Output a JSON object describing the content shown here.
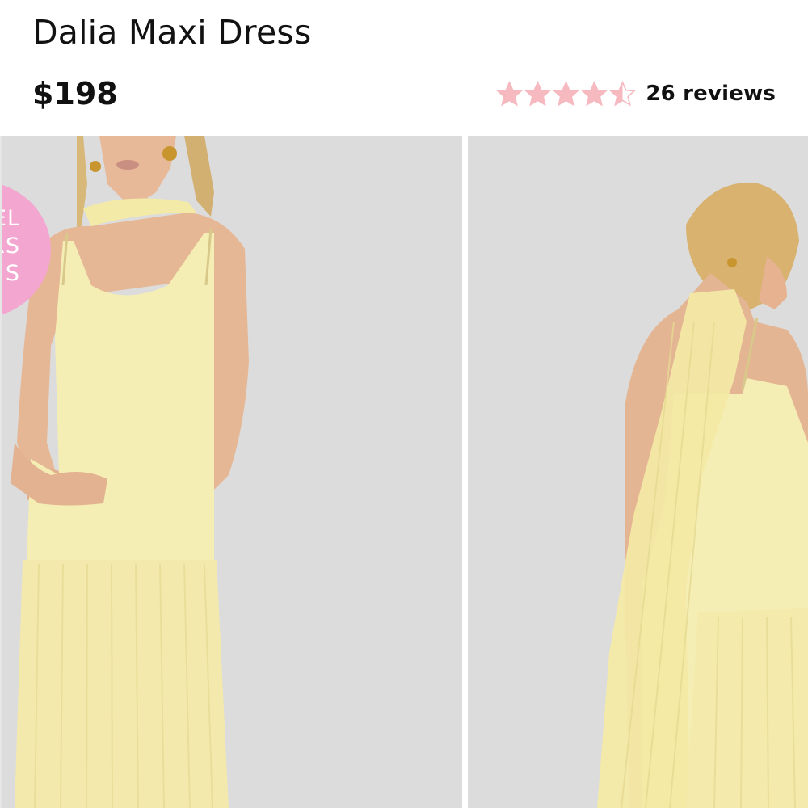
{
  "product": {
    "title": "Dalia Maxi Dress",
    "price": "$198"
  },
  "rating": {
    "value": 4.5,
    "max": 5,
    "reviews_label": "26 reviews",
    "star_color": "#f6b9bf",
    "star_empty_color": "#f6b9bf"
  },
  "gallery": {
    "badge": {
      "lines": [
        "EL",
        "RS",
        "S"
      ],
      "color": "#f3a6cf"
    },
    "background_color": "#dcdcdc",
    "dress_color": "#f6eda8"
  }
}
